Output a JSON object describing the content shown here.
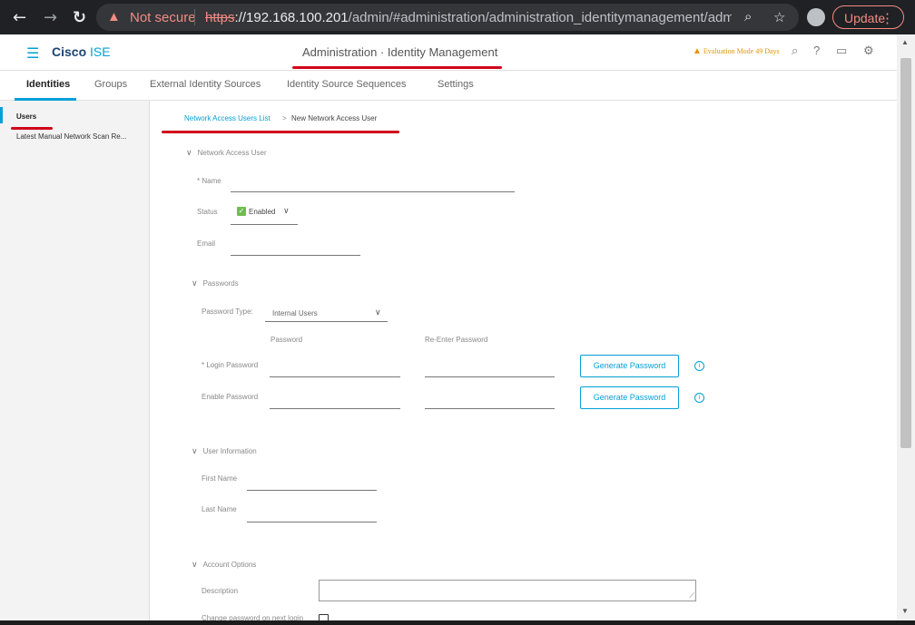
{
  "browser": {
    "not_secure": "Not secure",
    "url_scheme": "https",
    "url_host": "://192.168.100.201",
    "url_path": "/admin/#administration/administration_identitymanagement/administr...",
    "update_label": "Update"
  },
  "header": {
    "brand_primary": "Cisco",
    "brand_secondary": "ISE",
    "title": "Administration · Identity Management",
    "evaluation": "Evaluation Mode 49 Days"
  },
  "tabs": [
    {
      "label": "Identities"
    },
    {
      "label": "Groups"
    },
    {
      "label": "External Identity Sources"
    },
    {
      "label": "Identity Source Sequences"
    },
    {
      "label": "Settings"
    }
  ],
  "sidebar": {
    "items": [
      {
        "label": "Users"
      },
      {
        "label": "Latest Manual Network Scan Re..."
      }
    ]
  },
  "breadcrumb": {
    "link": "Network Access Users List",
    "separator": ">",
    "current": "New Network Access User"
  },
  "network_access_user": {
    "heading": "Network Access User",
    "name_label": "* Name",
    "status_label": "Status",
    "status_value": "Enabled",
    "email_label": "Email"
  },
  "passwords": {
    "heading": "Passwords",
    "type_label": "Password Type:",
    "type_value": "Internal Users",
    "col_password": "Password",
    "col_reenter": "Re-Enter Password",
    "login_label": "* Login Password",
    "enable_label": "Enable Password",
    "generate_label": "Generate Password"
  },
  "user_information": {
    "heading": "User Information",
    "first_name_label": "First Name",
    "last_name_label": "Last Name"
  },
  "account_options": {
    "heading": "Account Options",
    "description_label": "Description",
    "change_password_label": "Change password on next login"
  },
  "colors": {
    "accent": "#049fd9",
    "brand_dark": "#1e4471",
    "annotation_red": "#d0021b",
    "enabled_green": "#6cc04a",
    "warning": "#e69500"
  }
}
